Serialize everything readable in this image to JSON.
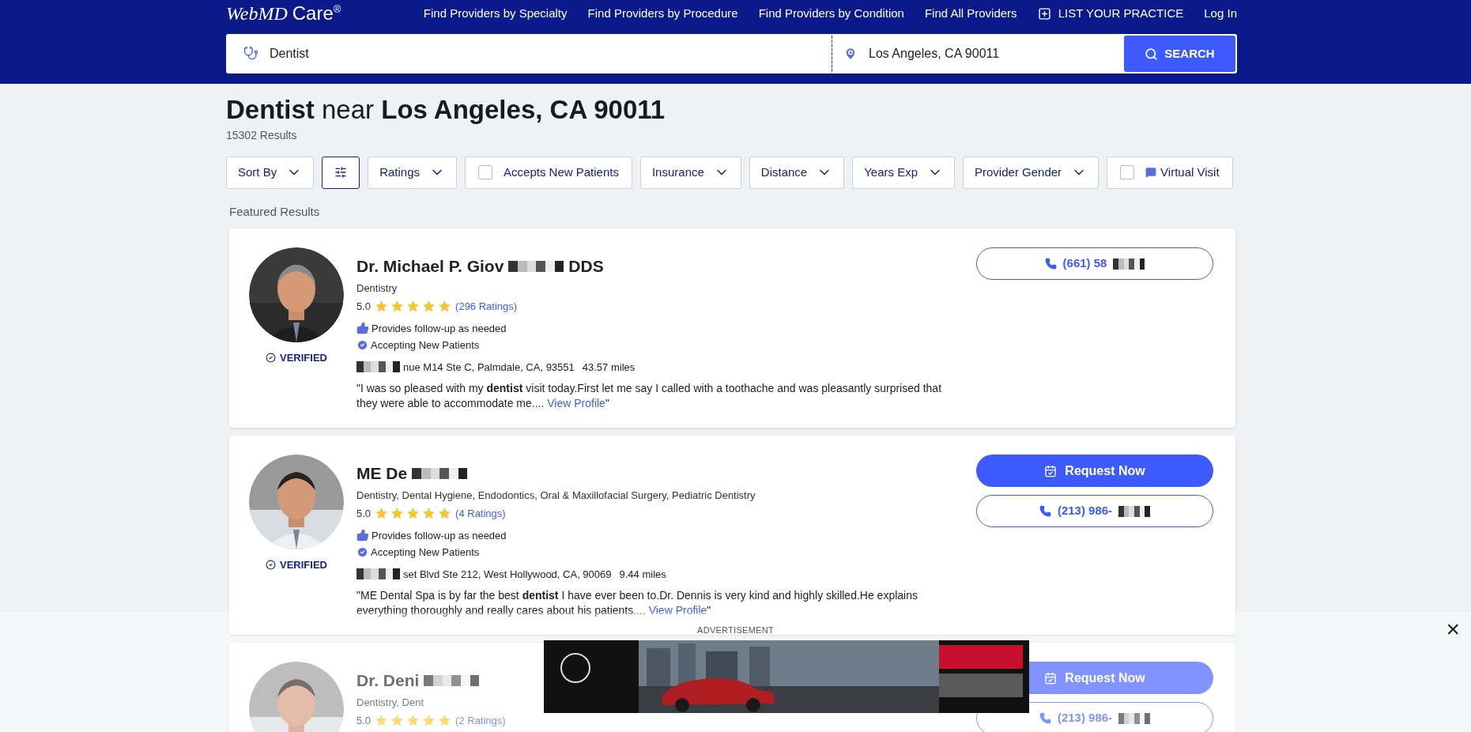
{
  "header": {
    "logo": "WebMD",
    "logo_sub": "Care",
    "logo_mark": "®",
    "nav": [
      "Find Providers by Specialty",
      "Find Providers by Procedure",
      "Find Providers by Condition",
      "Find All Providers"
    ],
    "list_practice": "LIST YOUR PRACTICE",
    "login": "Log In"
  },
  "search": {
    "query": "Dentist",
    "location": "Los Angeles, CA 90011",
    "button": "SEARCH"
  },
  "heading": {
    "specialty": "Dentist",
    "near": "near",
    "location": "Los Angeles, CA 90011"
  },
  "results_count": "15302 Results",
  "filters": [
    {
      "kind": "dropdown",
      "label": "Sort By"
    },
    {
      "kind": "icon"
    },
    {
      "kind": "dropdown",
      "label": "Ratings"
    },
    {
      "kind": "checkbox",
      "label": "Accepts New Patients",
      "checked": false
    },
    {
      "kind": "dropdown",
      "label": "Insurance"
    },
    {
      "kind": "dropdown",
      "label": "Distance"
    },
    {
      "kind": "dropdown",
      "label": "Years Exp"
    },
    {
      "kind": "dropdown",
      "label": "Provider Gender"
    },
    {
      "kind": "chat-checkbox",
      "label": "Virtual Visit",
      "checked": false
    }
  ],
  "section_label": "Featured Results",
  "providers": [
    {
      "name": "Dr. Michael P. Giov",
      "name_redacted": true,
      "name_suffix": "DDS",
      "specialties": "Dentistry",
      "rating": "5.0",
      "stars": 5,
      "ratings_link": "(296 Ratings)",
      "verified": "VERIFIED",
      "features": [
        {
          "kind": "thumb",
          "text": "Provides follow-up as needed"
        },
        {
          "kind": "check",
          "text": "Accepting New Patients"
        }
      ],
      "address_redacted": true,
      "address": "nue M14 Ste C, Palmdale, CA, 93551",
      "distance": "43.57 miles",
      "review": "\"I was so pleased with my **dentist** visit today.First let me say I called with a toothache and was pleasantly surprised that they were able to accommodate me....",
      "review_link": "View Profile",
      "review_end": "\"",
      "actions": [
        {
          "kind": "call",
          "label": "(661) 58",
          "redacted": true
        }
      ]
    },
    {
      "name": "ME De",
      "name_redacted": true,
      "specialties": "Dentistry, Dental Hygiene, Endodontics, Oral & Maxillofacial Surgery, Pediatric Dentistry",
      "rating": "5.0",
      "stars": 5,
      "ratings_link": "(4 Ratings)",
      "verified": "VERIFIED",
      "features": [
        {
          "kind": "thumb",
          "text": "Provides follow-up as needed"
        },
        {
          "kind": "check",
          "text": "Accepting New Patients"
        }
      ],
      "address_redacted": true,
      "address": "set Blvd Ste 212, West Hollywood, CA, 90069",
      "distance": "9.44 miles",
      "review": "\"ME Dental Spa is by far the best **dentist** I have ever been to.Dr. Dennis is very kind and highly skilled.He explains everything thoroughly and really cares about his patients....",
      "review_link": "View Profile",
      "review_end": "\"",
      "actions": [
        {
          "kind": "request",
          "label": "Request Now"
        },
        {
          "kind": "call",
          "label": "(213) 986-",
          "redacted": true
        }
      ]
    },
    {
      "name": "Dr. Deni",
      "name_redacted": true,
      "specialties": "Dentistry, Dent",
      "rating": "5.0",
      "stars": 5,
      "ratings_link": "(2 Ratings)",
      "actions": [
        {
          "kind": "request",
          "label": "Request Now"
        },
        {
          "kind": "call",
          "label": "(213) 986-",
          "redacted": true
        }
      ]
    }
  ],
  "ad": {
    "label": "ADVERTISEMENT",
    "close": "×"
  }
}
